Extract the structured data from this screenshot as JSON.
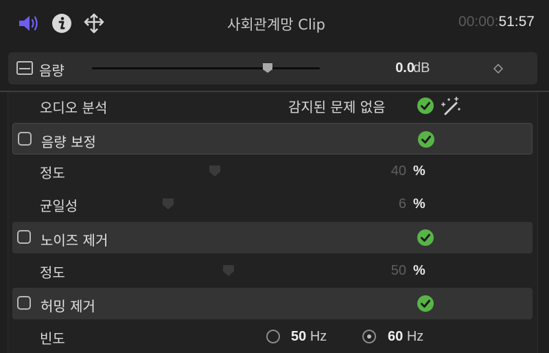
{
  "header": {
    "clip_title": "사회관계망 Clip",
    "timecode_dim": "00:00:",
    "timecode_bright": "51:57",
    "icons": [
      "speaker-icon",
      "info-icon",
      "transform-arrows-icon"
    ],
    "accent_color": "#6f5cf0"
  },
  "volume": {
    "label": "음량",
    "value": "0.0",
    "unit": "dB",
    "slider_fraction": 0.77
  },
  "analysis": {
    "label": "오디오 분석",
    "status": "감지된 문제 없음",
    "ok_color": "#58b447"
  },
  "sections": [
    {
      "label": "음량 보정",
      "params": [
        {
          "label": "정도",
          "value": "40",
          "unit": "%",
          "fraction": 0.4
        },
        {
          "label": "균일성",
          "value": "6",
          "unit": "%",
          "fraction": 0.06
        }
      ]
    },
    {
      "label": "노이즈 제거",
      "params": [
        {
          "label": "정도",
          "value": "50",
          "unit": "%",
          "fraction": 0.5
        }
      ]
    },
    {
      "label": "허밍 제거",
      "frequency": {
        "label": "빈도",
        "options": [
          {
            "value": "50",
            "unit": "Hz",
            "selected": false
          },
          {
            "value": "60",
            "unit": "Hz",
            "selected": true
          }
        ]
      }
    }
  ]
}
